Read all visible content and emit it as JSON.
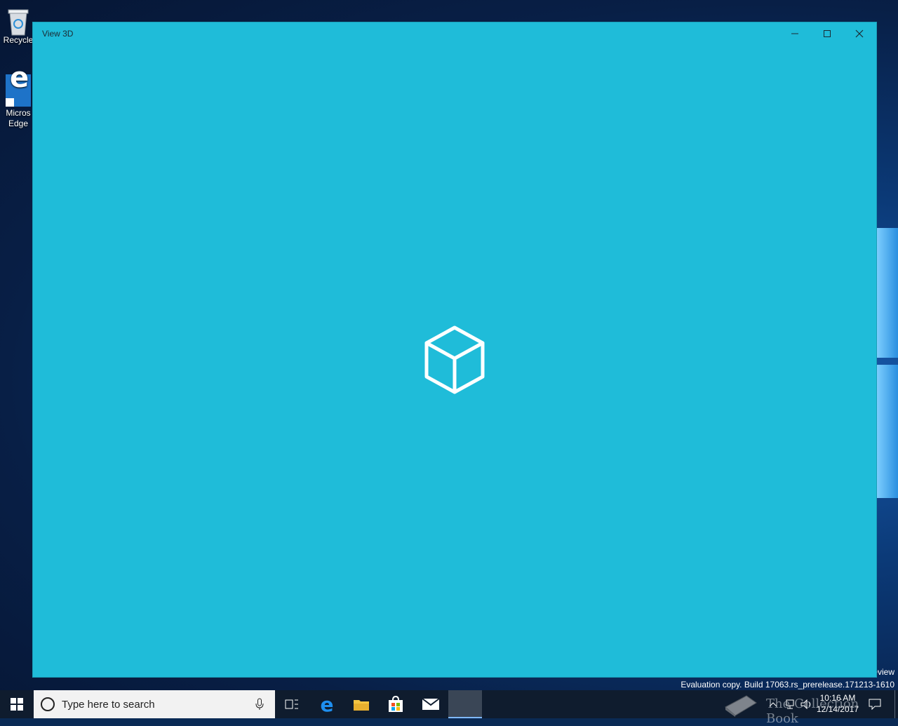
{
  "desktop": {
    "icons": [
      {
        "label": "Recycle"
      },
      {
        "label_line1": "Micros",
        "label_line2": "Edge"
      }
    ],
    "watermark_preview": "eview",
    "watermark_eval": "Evaluation copy. Build 17063.rs_prerelease.171213-1610",
    "overlay_brand": "The Collection Book"
  },
  "window": {
    "title": "View 3D",
    "background_color": "#1fbcd9",
    "center_icon": "cube-icon"
  },
  "taskbar": {
    "search_placeholder": "Type here to search",
    "time": "10:16 AM",
    "date": "12/14/2017",
    "pinned": [
      "start-icon",
      "cortana-icon",
      "microphone-icon",
      "task-view-icon",
      "edge-icon",
      "file-explorer-icon",
      "store-icon",
      "mail-icon",
      "view3d-app"
    ]
  }
}
